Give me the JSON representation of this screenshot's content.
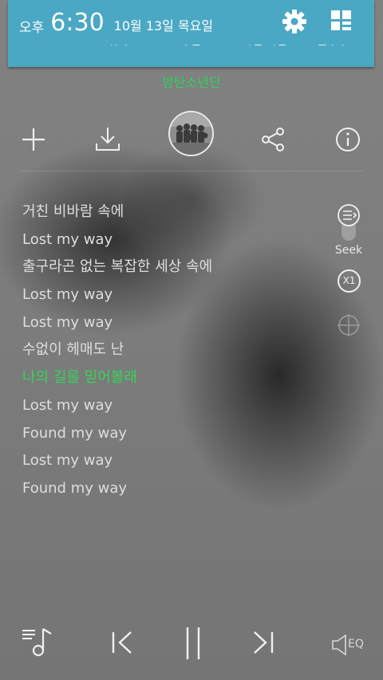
{
  "status_bar": {
    "ampm": "오후",
    "time": "6:30",
    "date": "10월 13일 목요일",
    "settings_icon": "gear-icon",
    "quick_panel_icon": "grid-icon"
  },
  "quick_toggles": [
    "Wi-Fi",
    "위치",
    "무음",
    "화면 회전",
    "블루투스"
  ],
  "artist": "방탄소년단",
  "toolbar": {
    "add_icon": "plus-icon",
    "download_icon": "download-icon",
    "share_icon": "share-icon",
    "info_icon": "info-icon"
  },
  "lyrics": [
    {
      "text": "거친 비바람 속에",
      "active": false
    },
    {
      "text": "Lost my way",
      "active": false
    },
    {
      "text": "출구라곤 없는 복잡한 세상 속에",
      "active": false
    },
    {
      "text": "Lost my way",
      "active": false
    },
    {
      "text": "Lost my way",
      "active": false
    },
    {
      "text": "수없이 헤매도 난",
      "active": false
    },
    {
      "text": "나의 길을 믿어볼래",
      "active": true
    },
    {
      "text": "Lost my way",
      "active": false
    },
    {
      "text": "Found my way",
      "active": false
    },
    {
      "text": "Lost my way",
      "active": false
    },
    {
      "text": "Found my way",
      "active": false
    }
  ],
  "side_controls": {
    "seek_label": "Seek",
    "speed_label": "X1"
  },
  "bottom": {
    "eq_label": "EQ"
  },
  "colors": {
    "status_bar": "#4aa8c4",
    "accent_green": "#2ed05a"
  }
}
